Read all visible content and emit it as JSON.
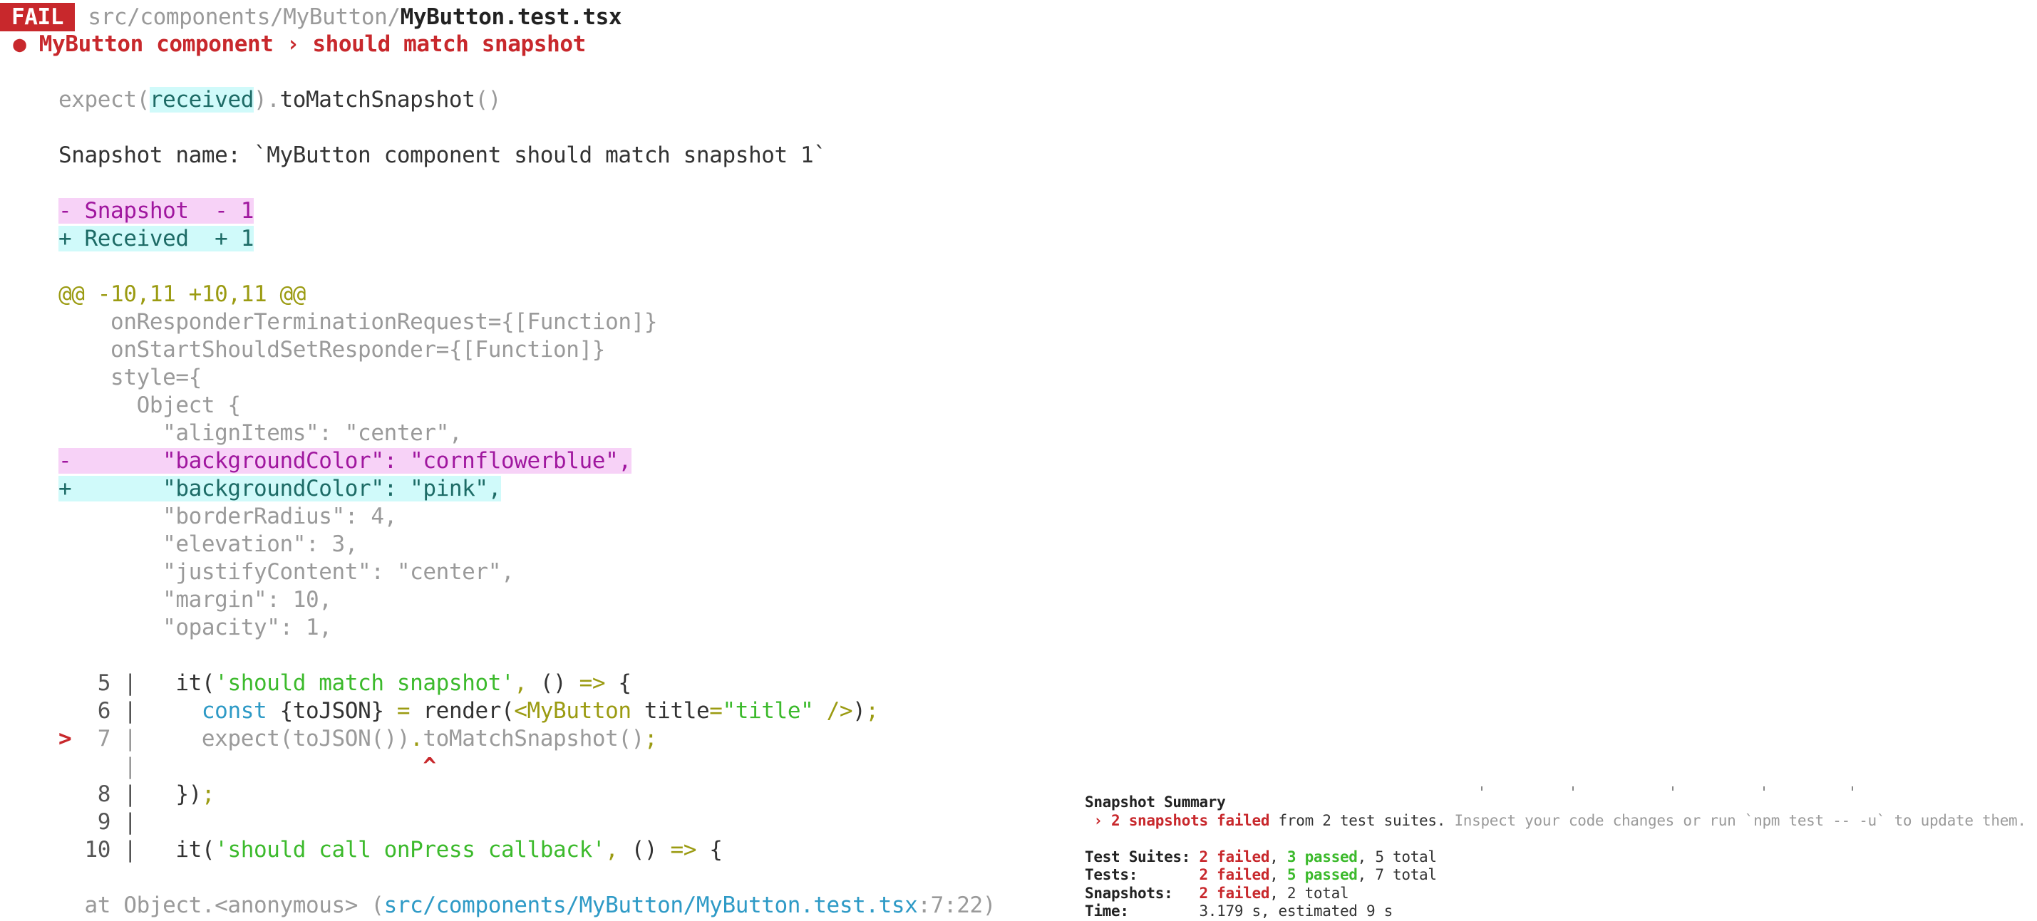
{
  "colors": {
    "fail": "#c8282c",
    "pass": "#3cba2c",
    "snapshot_bg": "#f7d2f7",
    "received_bg": "#d0fafa",
    "link": "#2e9ac6"
  },
  "lines": [
    {
      "segs": [
        {
          "t": "FAIL",
          "s": "badge"
        },
        {
          "t": " src/components/MyButton/",
          "s": "g"
        },
        {
          "t": "MyButton.test.tsx",
          "s": "db"
        }
      ]
    },
    {
      "segs": [
        {
          "t": " ● MyButton component › should match snapshot",
          "s": "rb"
        }
      ],
      "indent": true
    },
    {
      "segs": []
    },
    {
      "segs": [
        {
          "t": "expect(",
          "s": "g"
        },
        {
          "t": "received",
          "s": "t"
        },
        {
          "t": ").",
          "s": "g"
        },
        {
          "t": "toMatchSnapshot",
          "s": "d"
        },
        {
          "t": "()",
          "s": "g"
        }
      ]
    },
    {
      "segs": []
    },
    {
      "segs": [
        {
          "t": "Snapshot name: `MyButton component should match snapshot 1`",
          "s": "d"
        }
      ]
    },
    {
      "segs": []
    },
    {
      "segs": [
        {
          "t": "- Snapshot  - 1",
          "s": "p"
        }
      ]
    },
    {
      "segs": [
        {
          "t": "+ Received  + 1",
          "s": "t"
        }
      ]
    },
    {
      "segs": []
    },
    {
      "segs": [
        {
          "t": "@@ -10,11 +10,11 @@",
          "s": "o"
        }
      ]
    },
    {
      "segs": [
        {
          "t": "    onResponderTerminationRequest={[Function]}",
          "s": "g"
        }
      ]
    },
    {
      "segs": [
        {
          "t": "    onStartShouldSetResponder={[Function]}",
          "s": "g"
        }
      ]
    },
    {
      "segs": [
        {
          "t": "    style={",
          "s": "g"
        }
      ]
    },
    {
      "segs": [
        {
          "t": "      Object {",
          "s": "g"
        }
      ]
    },
    {
      "segs": [
        {
          "t": "        \"alignItems\": \"center\",",
          "s": "g"
        }
      ]
    },
    {
      "segs": [
        {
          "t": "-       \"backgroundColor\": \"cornflowerblue\",",
          "s": "p"
        }
      ]
    },
    {
      "segs": [
        {
          "t": "+       \"backgroundColor\": \"pink\",",
          "s": "t"
        }
      ]
    },
    {
      "segs": [
        {
          "t": "        \"borderRadius\": 4,",
          "s": "g"
        }
      ]
    },
    {
      "segs": [
        {
          "t": "        \"elevation\": 3,",
          "s": "g"
        }
      ]
    },
    {
      "segs": [
        {
          "t": "        \"justifyContent\": \"center\",",
          "s": "g"
        }
      ]
    },
    {
      "segs": [
        {
          "t": "        \"margin\": 10,",
          "s": "g"
        }
      ]
    },
    {
      "segs": [
        {
          "t": "        \"opacity\": 1,",
          "s": "g"
        }
      ]
    },
    {
      "segs": []
    },
    {
      "segs": [
        {
          "t": "   5 |",
          "s": "n"
        },
        {
          "t": "   it(",
          "s": "d"
        },
        {
          "t": "'should match snapshot'",
          "s": "gr"
        },
        {
          "t": ",",
          "s": "o"
        },
        {
          "t": " () ",
          "s": "d"
        },
        {
          "t": "=>",
          "s": "o"
        },
        {
          "t": " {",
          "s": "d"
        }
      ]
    },
    {
      "segs": [
        {
          "t": "   6 |",
          "s": "n"
        },
        {
          "t": "     ",
          "s": "d"
        },
        {
          "t": "const",
          "s": "b"
        },
        {
          "t": " {toJSON} ",
          "s": "d"
        },
        {
          "t": "=",
          "s": "o"
        },
        {
          "t": " render(",
          "s": "d"
        },
        {
          "t": "<MyButton",
          "s": "o"
        },
        {
          "t": " title",
          "s": "d"
        },
        {
          "t": "=",
          "s": "o"
        },
        {
          "t": "\"title\"",
          "s": "gr"
        },
        {
          "t": " />",
          "s": "o"
        },
        {
          "t": ")",
          "s": "d"
        },
        {
          "t": ";",
          "s": "o"
        }
      ]
    },
    {
      "segs": [
        {
          "t": ">",
          "s": "rb"
        },
        {
          "t": "  7 |",
          "s": "g"
        },
        {
          "t": "     expect(toJSON())",
          "s": "g"
        },
        {
          "t": ".",
          "s": "o"
        },
        {
          "t": "toMatchSnapshot()",
          "s": "g"
        },
        {
          "t": ";",
          "s": "o"
        }
      ]
    },
    {
      "segs": [
        {
          "t": "     |",
          "s": "g"
        },
        {
          "t": "                      ^",
          "s": "rb"
        }
      ]
    },
    {
      "segs": [
        {
          "t": "   8 |",
          "s": "n"
        },
        {
          "t": "   })",
          "s": "d"
        },
        {
          "t": ";",
          "s": "o"
        }
      ]
    },
    {
      "segs": [
        {
          "t": "   9 |",
          "s": "n"
        }
      ]
    },
    {
      "segs": [
        {
          "t": "  10 |",
          "s": "n"
        },
        {
          "t": "   it(",
          "s": "d"
        },
        {
          "t": "'should call onPress callback'",
          "s": "gr"
        },
        {
          "t": ",",
          "s": "o"
        },
        {
          "t": " () ",
          "s": "d"
        },
        {
          "t": "=>",
          "s": "o"
        },
        {
          "t": " {",
          "s": "d"
        }
      ]
    },
    {
      "segs": []
    },
    {
      "segs": [
        {
          "t": "  at Object.<anonymous> (",
          "s": "g"
        },
        {
          "t": "src/components/MyButton/MyButton.test.tsx",
          "s": "b"
        },
        {
          "t": ":7:22)",
          "s": "g"
        }
      ]
    }
  ],
  "summary": [
    {
      "segs": [
        {
          "t": "Snapshot Summary",
          "s": "db"
        }
      ]
    },
    {
      "segs": [
        {
          "t": " › 2 snapshots failed",
          "s": "rb"
        },
        {
          "t": " from 2 test suites. ",
          "s": "d"
        },
        {
          "t": "Inspect your code changes or run `npm test -- -u` to update them.",
          "s": "g"
        }
      ]
    },
    {
      "segs": []
    },
    {
      "segs": [
        {
          "t": "Test Suites: ",
          "s": "db"
        },
        {
          "t": "2 failed",
          "s": "rb"
        },
        {
          "t": ", ",
          "s": "d"
        },
        {
          "t": "3 passed",
          "s": "grb"
        },
        {
          "t": ", 5 total",
          "s": "d"
        }
      ]
    },
    {
      "segs": [
        {
          "t": "Tests:       ",
          "s": "db"
        },
        {
          "t": "2 failed",
          "s": "rb"
        },
        {
          "t": ", ",
          "s": "d"
        },
        {
          "t": "5 passed",
          "s": "grb"
        },
        {
          "t": ", 7 total",
          "s": "d"
        }
      ]
    },
    {
      "segs": [
        {
          "t": "Snapshots:   ",
          "s": "db"
        },
        {
          "t": "2 failed",
          "s": "rb"
        },
        {
          "t": ", 2 total",
          "s": "d"
        }
      ]
    },
    {
      "segs": [
        {
          "t": "Time:        ",
          "s": "db"
        },
        {
          "t": "3.179 s, estimated 9 s",
          "s": "d"
        }
      ]
    }
  ]
}
